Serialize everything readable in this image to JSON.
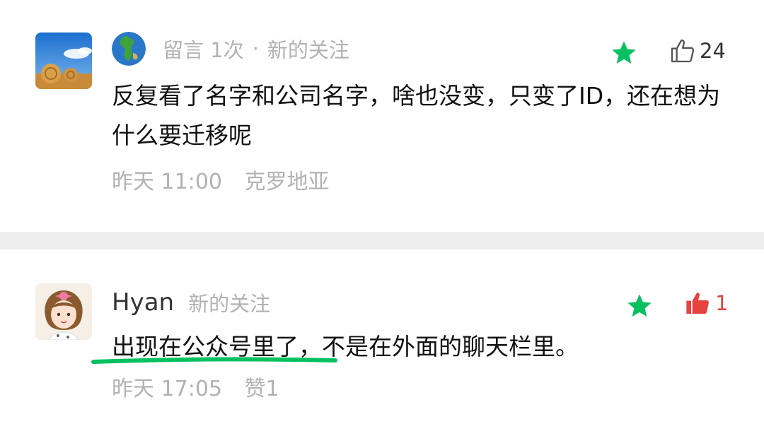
{
  "comments": [
    {
      "meta_count": "留言 1次",
      "separator": "·",
      "status": "新的关注",
      "text": "反复看了名字和公司名字，啥也没变，只变了ID，还在想为什么要迁移呢",
      "time": "昨天 11:00",
      "location": "克罗地亚",
      "like_count": "24",
      "like_icon": "thumbs-up-outline-icon",
      "star_icon": "star-icon",
      "colors": {
        "star": "#07c160",
        "meta": "#b2b2b2"
      }
    },
    {
      "nickname": "Hyan",
      "status": "新的关注",
      "text": "出现在公众号里了，不是在外面的聊天栏里。",
      "time": "昨天 17:05",
      "likes_footer": "赞1",
      "like_count": "1",
      "like_icon": "thumbs-up-filled-icon",
      "star_icon": "star-icon",
      "colors": {
        "star": "#07c160",
        "like": "#e64340",
        "underline": "#07c160"
      }
    }
  ]
}
